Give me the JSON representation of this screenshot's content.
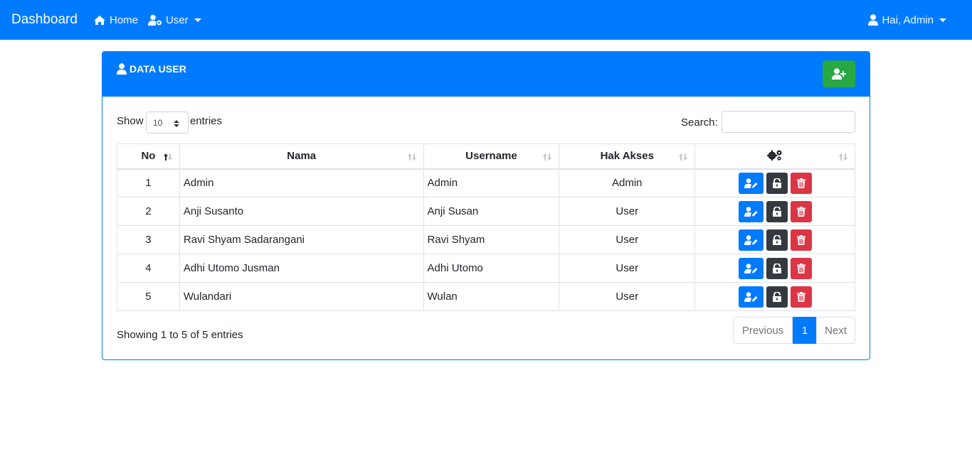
{
  "navbar": {
    "brand": "Dashboard",
    "home_label": "Home",
    "user_label": "User",
    "account_label": "Hai, Admin"
  },
  "card": {
    "title": "DATA USER",
    "add_button_icon": "user-plus-icon"
  },
  "table_controls": {
    "show_label": "Show",
    "length_value": "10",
    "entries_label": "entries",
    "search_label": "Search:",
    "search_value": ""
  },
  "table": {
    "columns": [
      "No",
      "Nama",
      "Username",
      "Hak Akses"
    ],
    "action_column_icon": "cogs-icon",
    "rows": [
      {
        "no": "1",
        "nama": "Admin",
        "username": "Admin",
        "hak": "Admin"
      },
      {
        "no": "2",
        "nama": "Anji Susanto",
        "username": "Anji Susan",
        "hak": "User"
      },
      {
        "no": "3",
        "nama": "Ravi Shyam Sadarangani",
        "username": "Ravi Shyam",
        "hak": "User"
      },
      {
        "no": "4",
        "nama": "Adhi Utomo Jusman",
        "username": "Adhi Utomo",
        "hak": "User"
      },
      {
        "no": "5",
        "nama": "Wulandari",
        "username": "Wulan",
        "hak": "User"
      }
    ]
  },
  "footer": {
    "info": "Showing 1 to 5 of 5 entries",
    "prev": "Previous",
    "page": "1",
    "next": "Next"
  },
  "colors": {
    "primary": "#007bff",
    "success": "#28a745",
    "dark": "#343a40",
    "danger": "#dc3545"
  }
}
